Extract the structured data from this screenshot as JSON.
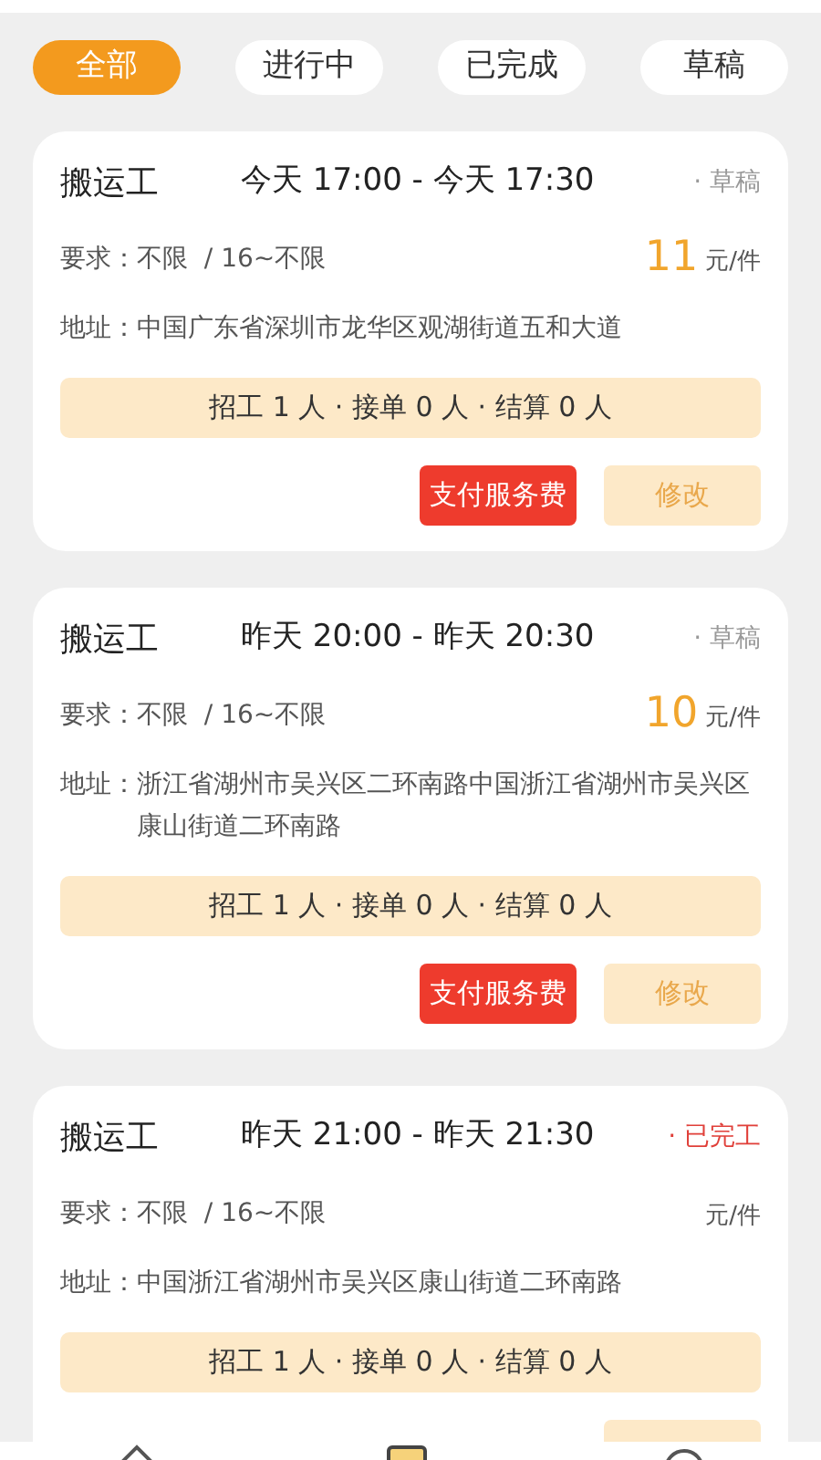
{
  "tabs": [
    {
      "label": "全部",
      "selected": true
    },
    {
      "label": "进行中",
      "selected": false
    },
    {
      "label": "已完成",
      "selected": false
    },
    {
      "label": "草稿",
      "selected": false
    }
  ],
  "cards": [
    {
      "title": "搬运工",
      "time": "今天 17:00 - 今天 17:30",
      "status": {
        "kind": "draft",
        "label": "· 草稿"
      },
      "requirement": "要求：不限  / 16~不限",
      "price": "11",
      "unit": "元/件",
      "address_label": "地址：",
      "address": "中国广东省深圳市龙华区观湖街道五和大道",
      "summary": "招工 1 人 · 接单 0 人 · 结算 0 人",
      "buttons": [
        {
          "kind": "primary",
          "label": "支付服务费"
        },
        {
          "kind": "secondary",
          "label": "修改"
        }
      ]
    },
    {
      "title": "搬运工",
      "time": "昨天 20:00 - 昨天 20:30",
      "status": {
        "kind": "draft",
        "label": "· 草稿"
      },
      "requirement": "要求：不限  / 16~不限",
      "price": "10",
      "unit": "元/件",
      "address_label": "地址：",
      "address": "浙江省湖州市吴兴区二环南路中国浙江省湖州市吴兴区康山街道二环南路",
      "summary": "招工 1 人 · 接单 0 人 · 结算 0 人",
      "buttons": [
        {
          "kind": "primary",
          "label": "支付服务费"
        },
        {
          "kind": "secondary",
          "label": "修改"
        }
      ]
    },
    {
      "title": "搬运工",
      "time": "昨天 21:00 - 昨天 21:30",
      "status": {
        "kind": "done",
        "label": "· 已完工"
      },
      "requirement": "要求：不限  / 16~不限",
      "unit": "元/件",
      "address_label": "地址：",
      "address": "中国浙江省湖州市吴兴区康山街道二环南路",
      "summary": "招工 1 人 · 接单 0 人 · 结算 0 人",
      "buttons": [
        {
          "kind": "secondary"
        }
      ]
    }
  ]
}
